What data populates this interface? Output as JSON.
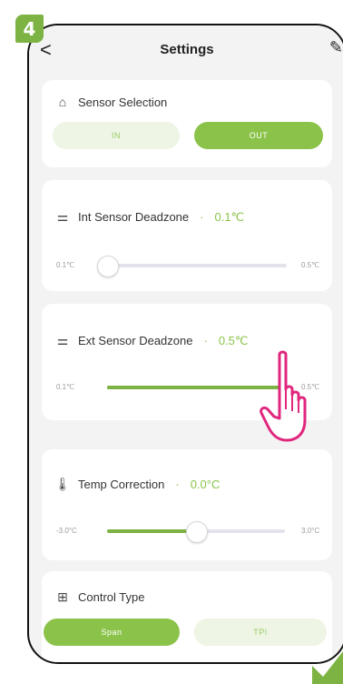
{
  "step": "4",
  "header": {
    "title": "Settings",
    "back": "<",
    "edit": "✎"
  },
  "sensor_selection": {
    "label": "Sensor Selection",
    "options": [
      "IN",
      "OUT"
    ],
    "selected": "OUT"
  },
  "int_deadzone": {
    "label": "Int Sensor Deadzone",
    "value": "0.1℃",
    "min": "0.1℃",
    "max": "0.5℃",
    "fraction": 0.0
  },
  "ext_deadzone": {
    "label": "Ext Sensor Deadzone",
    "value": "0.5℃",
    "min": "0.1℃",
    "max": "0.5℃",
    "fraction": 1.0
  },
  "temp_correction": {
    "label": "Temp Correction",
    "value": "0.0°C",
    "min": "-3.0°C",
    "max": "3.0°C",
    "fraction": 0.5
  },
  "control_type": {
    "label": "Control Type",
    "options": [
      "Span",
      "TPI"
    ],
    "selected": "Span"
  },
  "colors": {
    "accent": "#8bc34a",
    "badge": "#7cb342",
    "hand": "#e0267d"
  },
  "icons": {
    "sensor": "home-sensor-icon",
    "deadzone": "sliders-icon",
    "temp": "thermometer-icon",
    "control": "grid-icon"
  }
}
